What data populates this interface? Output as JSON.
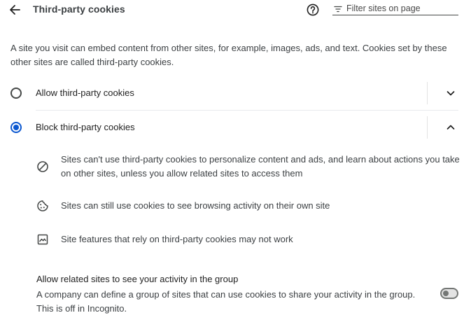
{
  "header": {
    "title": "Third-party cookies",
    "back_icon": "arrow-back-icon",
    "help_icon": "help-icon",
    "filter_icon": "filter-icon",
    "filter_placeholder": "Filter sites on page",
    "filter_value": ""
  },
  "description": {
    "line1": "A site you visit can embed content from other sites, for example, images, ads, and text. Cookies set by these",
    "line2": "other sites are called third-party cookies."
  },
  "options": [
    {
      "label": "Allow third-party cookies",
      "selected": false,
      "expanded": false
    },
    {
      "label": "Block third-party cookies",
      "selected": true,
      "expanded": true
    }
  ],
  "block_details": [
    {
      "icon": "block-icon",
      "line1": "Sites can't use third-party cookies to personalize content and ads, and learn about actions you take",
      "line2": "on other sites, unless you allow related sites to access them"
    },
    {
      "icon": "cookie-icon",
      "line1": "Sites can still use cookies to see browsing activity on their own site"
    },
    {
      "icon": "web-asset-broken-icon",
      "line1": "Site features that rely on third-party cookies may not work"
    }
  ],
  "related_sites": {
    "title": "Allow related sites to see your activity in the group",
    "line1": "A company can define a group of sites that can use cookies to share your activity in the group.",
    "line2": "This is off in Incognito.",
    "toggle_on": false
  },
  "colors": {
    "accent": "#0b57d0",
    "text_primary": "#1f1f1f",
    "text_secondary": "#3c4043",
    "divider": "#e3e3e3"
  }
}
